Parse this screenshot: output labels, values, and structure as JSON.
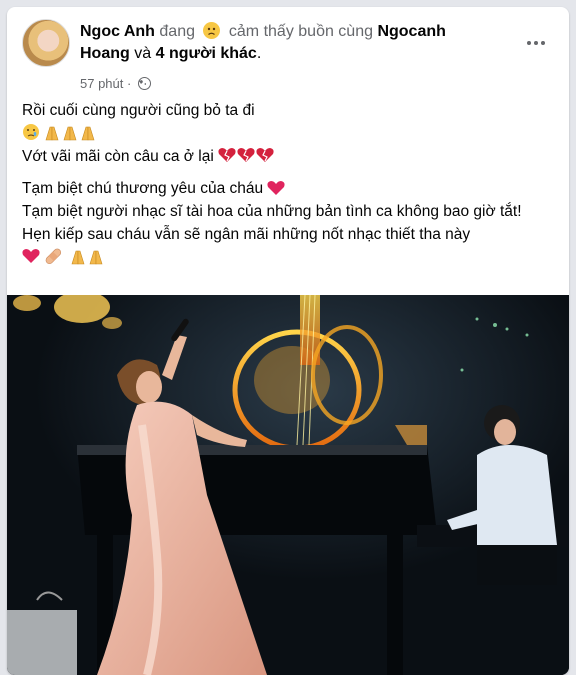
{
  "post": {
    "author": "Ngoc Anh",
    "feeling_prefix": "đang",
    "feeling_text": "cảm thấy buồn cùng",
    "tagged_first": "Ngocanh Hoang",
    "tagged_conj": "và",
    "tagged_others": "4 người khác",
    "tagged_end": ".",
    "time": "57 phút",
    "separator": "·",
    "privacy_icon": "globe-icon",
    "more_icon": "more-dots-icon",
    "lines": {
      "l1": "Rồi cuối cùng người cũng bỏ ta đi",
      "l3": "Vớt vãi mãi còn câu ca ở lại",
      "l4": "Tạm biệt chú thương yêu của cháu",
      "l5": "Tạm biệt người nhạc sĩ tài hoa của những bản tình ca không bao giờ tắt!",
      "l6": "Hẹn kiếp sau cháu vẫn sẽ ngân mãi những nốt nhạc thiết tha này"
    },
    "emojis": {
      "line2": "😢🙏🙏🙏",
      "line3_hearts": "💔💔💔",
      "line4_heart": "❤️",
      "line7": "❤️🩹 🙏🙏"
    },
    "colors": {
      "text": "#050505",
      "muted": "#65676b",
      "heart": "#e0245e"
    }
  }
}
